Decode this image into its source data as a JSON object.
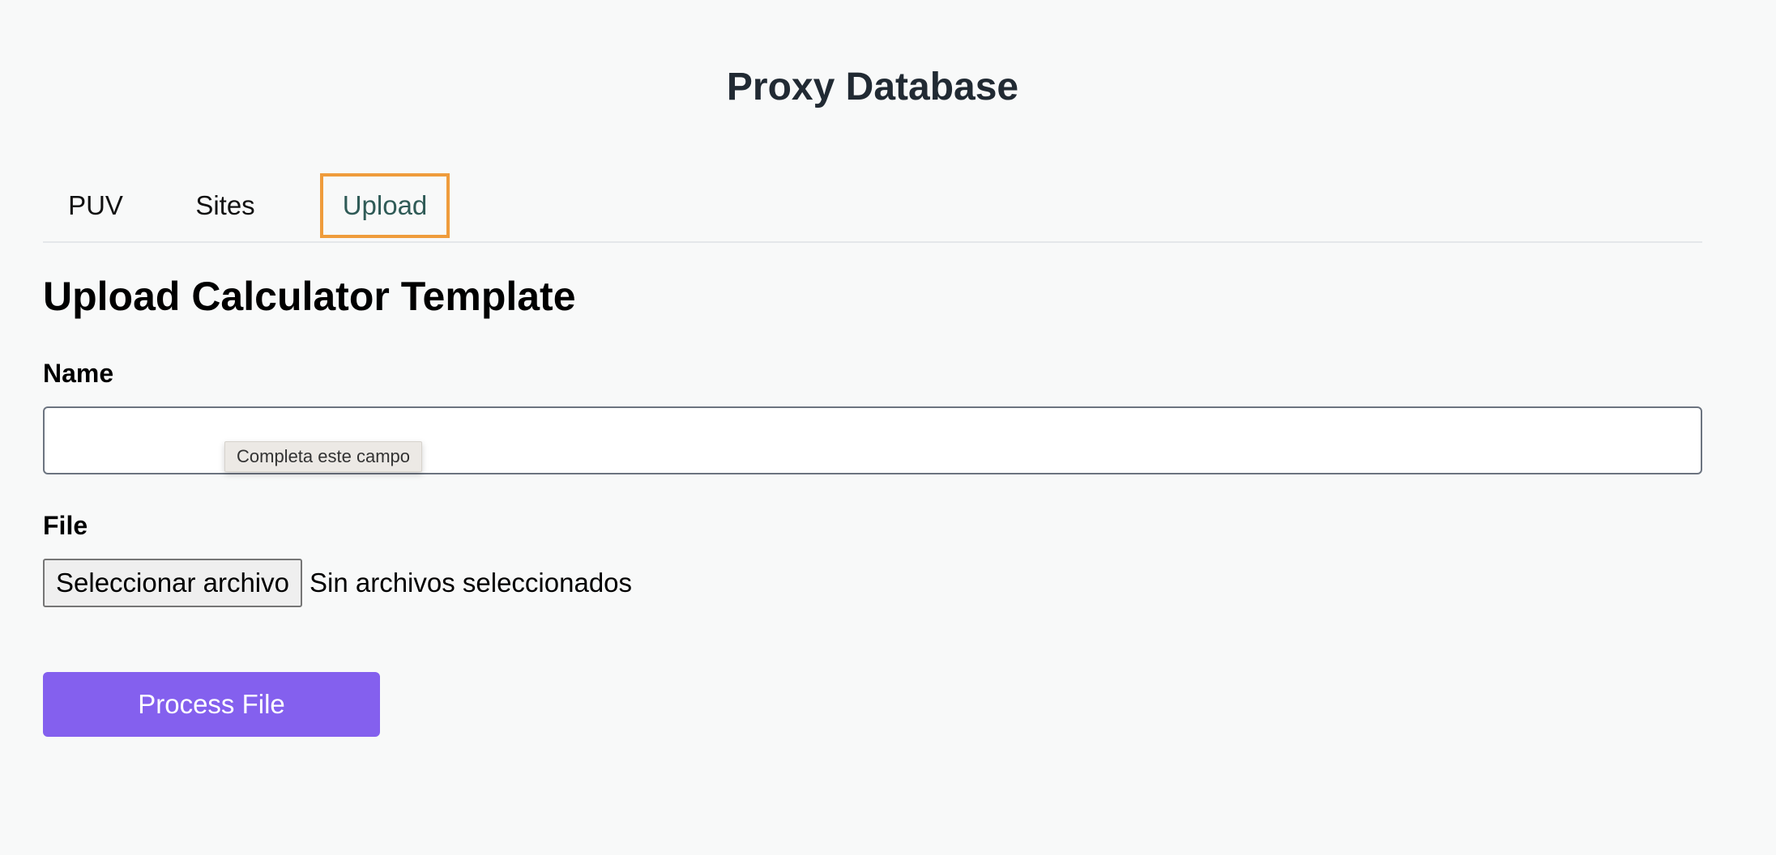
{
  "header": {
    "title": "Proxy Database"
  },
  "tabs": [
    {
      "label": "PUV",
      "active": false
    },
    {
      "label": "Sites",
      "active": false
    },
    {
      "label": "Upload",
      "active": true
    }
  ],
  "upload_form": {
    "heading": "Upload Calculator Template",
    "name_label": "Name",
    "name_value": "",
    "name_placeholder": "",
    "validation_tooltip": "Completa este campo",
    "file_label": "File",
    "file_button_label": "Seleccionar archivo",
    "file_status": "Sin archivos seleccionados",
    "submit_label": "Process File"
  },
  "colors": {
    "background": "#f8f9f9",
    "title": "#212a33",
    "active_tab_text": "#2f5b57",
    "active_tab_outline": "#ef9c3c",
    "primary_button": "#8460ee",
    "divider": "#e4e7ea"
  }
}
